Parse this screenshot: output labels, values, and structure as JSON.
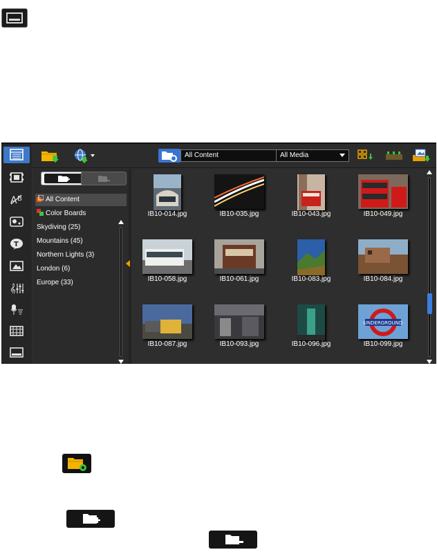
{
  "library": {
    "folder_combo_value": "All Content",
    "media_combo_value": "All Media",
    "tree_items": [
      {
        "label": "All Content"
      },
      {
        "label": "Color Boards"
      },
      {
        "label": "Skydiving (25)"
      },
      {
        "label": "Mountains (45)"
      },
      {
        "label": "Northern Lights (3)"
      },
      {
        "label": "London (6)"
      },
      {
        "label": "Europe (33)"
      }
    ],
    "thumbnails": [
      {
        "caption": "IB10-014.jpg"
      },
      {
        "caption": "IB10-035.jpg"
      },
      {
        "caption": "IB10-043.jpg"
      },
      {
        "caption": "IB10-049.jpg"
      },
      {
        "caption": "IB10-058.jpg"
      },
      {
        "caption": "IB10-061.jpg"
      },
      {
        "caption": "IB10-083.jpg"
      },
      {
        "caption": "IB10-084.jpg"
      },
      {
        "caption": "IB10-087.jpg"
      },
      {
        "caption": "IB10-093.jpg"
      },
      {
        "caption": "IB10-096.jpg"
      },
      {
        "caption": "IB10-099.jpg"
      }
    ],
    "thumb_sign_text": "UNDERGROUND"
  },
  "colors": {
    "accent_blue": "#3e78c8",
    "folder_yellow": "#f2b400",
    "panel_bg": "#2e2e2e",
    "arrow_orange": "#f0a000",
    "grid_icon_orange": "#e8a000",
    "download_green": "#3cc43c"
  },
  "icons": {
    "top": "captions-screen-icon",
    "rail": [
      "media-icon",
      "instant-project-icon",
      "transitions-icon",
      "filters-icon",
      "title-icon",
      "graphics-icon",
      "audio-mixer-icon",
      "record-capture-icon",
      "auto-music-icon",
      "subtitle-icon"
    ],
    "lower": [
      "folder-gear-icon",
      "new-folder-icon",
      "remove-folder-icon"
    ]
  }
}
